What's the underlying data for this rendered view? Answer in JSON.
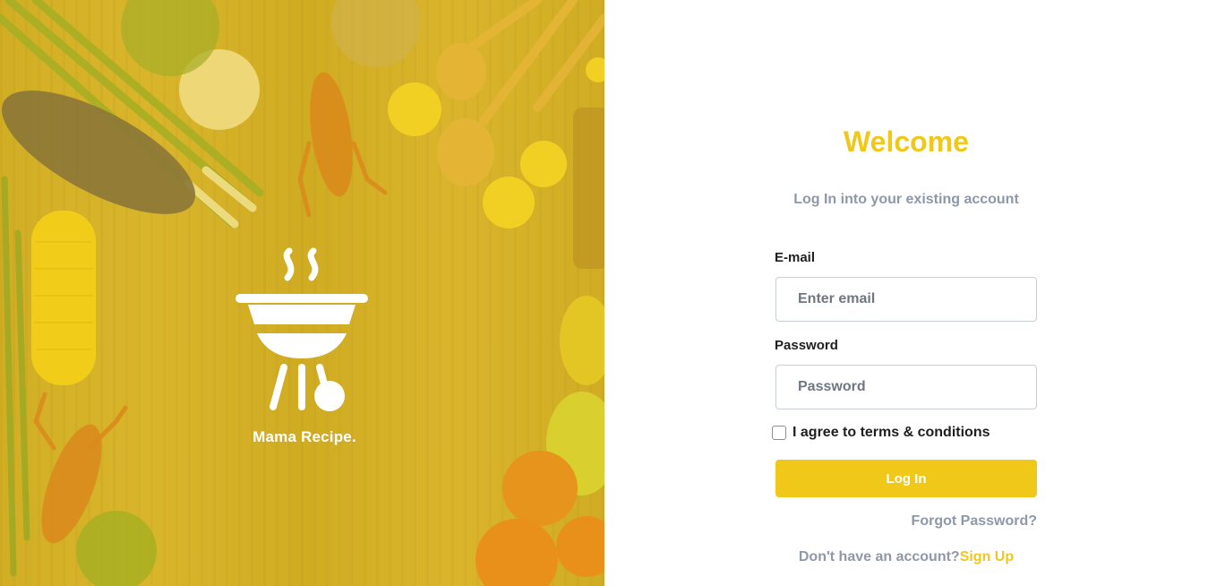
{
  "brand": {
    "name": "Mama Recipe.",
    "logo_icon": "grill-icon",
    "accent_color": "#efc81a"
  },
  "form": {
    "title": "Welcome",
    "subtitle": "Log In into your existing account",
    "email_label": "E-mail",
    "email_placeholder": "Enter email",
    "email_value": "",
    "password_label": "Password",
    "password_placeholder": "Password",
    "password_value": "",
    "terms_label": "I agree to terms & conditions",
    "terms_checked": false,
    "login_button": "Log In",
    "forgot_password": "Forgot Password?",
    "signup_prompt": "Don't have an account?",
    "signup_link": "Sign Up"
  },
  "colors": {
    "muted_text": "#8e98a8",
    "input_border": "#c9ced6"
  }
}
